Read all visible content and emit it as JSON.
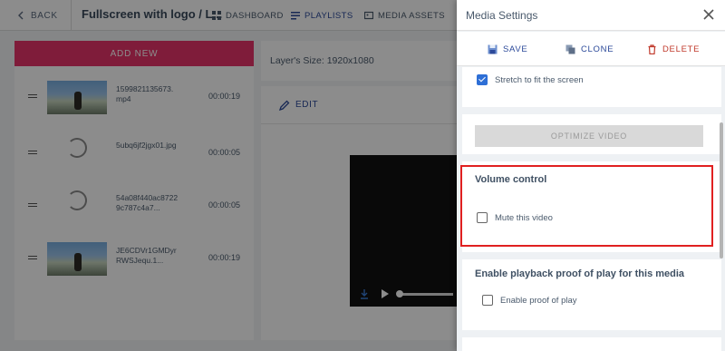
{
  "app": {
    "back_label": "BACK",
    "page_title": "Fullscreen with logo / L...",
    "nav": [
      {
        "label": "DASHBOARD",
        "icon": "grid-icon"
      },
      {
        "label": "PLAYLISTS",
        "icon": "playlist-icon"
      },
      {
        "label": "MEDIA ASSETS",
        "icon": "media-icon"
      }
    ],
    "add_new_label": "ADD NEW",
    "media_items": [
      {
        "file": "1599821135673.mp4",
        "duration": "00:00:19",
        "thumb": "beach-thumbnail"
      },
      {
        "file": "5ubq6jf2jgx01.jpg",
        "duration": "00:00:05",
        "thumb": "loading-spinner"
      },
      {
        "file": "54a08f440ac87229c787c4a7...",
        "duration": "00:00:05",
        "thumb": "loading-spinner"
      },
      {
        "file": "JE6CDVr1GMDyrRWSJequ.1...",
        "duration": "00:00:19",
        "thumb": "beach-thumbnail"
      }
    ],
    "layer_size": "Layer's Size: 1920x1080",
    "edit_label": "EDIT"
  },
  "drawer": {
    "title": "Media Settings",
    "actions": {
      "save": "SAVE",
      "clone": "CLONE",
      "delete": "DELETE"
    },
    "stretch_label": "Stretch to fit the screen",
    "stretch_checked": true,
    "optimize_label": "OPTIMIZE VIDEO",
    "volume": {
      "title": "Volume control",
      "mute_label": "Mute this video",
      "mute_checked": false
    },
    "proof": {
      "title": "Enable playback proof of play for this media",
      "enable_label": "Enable proof of play",
      "enable_checked": false
    }
  },
  "colors": {
    "accent": "#2c4a9a",
    "add_new": "#e8336a",
    "delete": "#c0392b",
    "checkbox_checked": "#2e6fd6",
    "highlight": "#e02020"
  }
}
